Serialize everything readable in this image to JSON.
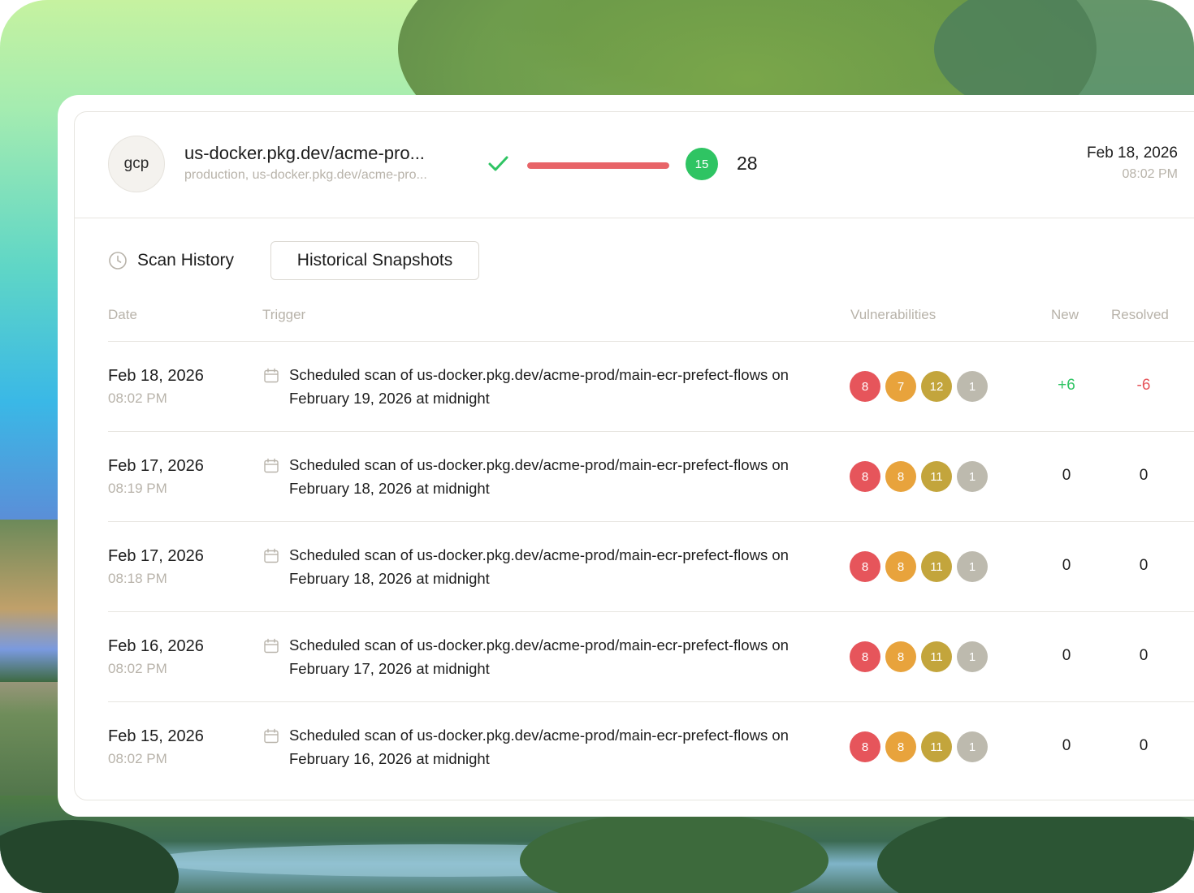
{
  "header": {
    "avatar_text": "gcp",
    "repo_title": "us-docker.pkg.dev/acme-pro...",
    "repo_subtitle": "production, us-docker.pkg.dev/acme-pro...",
    "progress_fraction": 1.0,
    "progress_color": "#e86468",
    "status_badge": "15",
    "total_count": "28",
    "date": "Feb 18, 2026",
    "time": "08:02 PM"
  },
  "tabs": {
    "history_label": "Scan History",
    "snapshots_label": "Historical Snapshots"
  },
  "table": {
    "columns": {
      "date": "Date",
      "trigger": "Trigger",
      "vulnerabilities": "Vulnerabilities",
      "new": "New",
      "resolved": "Resolved"
    },
    "rows": [
      {
        "date": "Feb 18, 2026",
        "time": "08:02 PM",
        "trigger": "Scheduled scan of us-docker.pkg.dev/acme-prod/main-ecr-prefect-flows on February 19, 2026 at midnight",
        "critical": "8",
        "high": "7",
        "medium": "12",
        "low": "1",
        "new": "+6",
        "resolved": "-6"
      },
      {
        "date": "Feb 17, 2026",
        "time": "08:19 PM",
        "trigger": "Scheduled scan of us-docker.pkg.dev/acme-prod/main-ecr-prefect-flows on February 18, 2026 at midnight",
        "critical": "8",
        "high": "8",
        "medium": "11",
        "low": "1",
        "new": "0",
        "resolved": "0"
      },
      {
        "date": "Feb 17, 2026",
        "time": "08:18 PM",
        "trigger": "Scheduled scan of us-docker.pkg.dev/acme-prod/main-ecr-prefect-flows on February 18, 2026 at midnight",
        "critical": "8",
        "high": "8",
        "medium": "11",
        "low": "1",
        "new": "0",
        "resolved": "0"
      },
      {
        "date": "Feb 16, 2026",
        "time": "08:02 PM",
        "trigger": "Scheduled scan of us-docker.pkg.dev/acme-prod/main-ecr-prefect-flows on February 17, 2026 at midnight",
        "critical": "8",
        "high": "8",
        "medium": "11",
        "low": "1",
        "new": "0",
        "resolved": "0"
      },
      {
        "date": "Feb 15, 2026",
        "time": "08:02 PM",
        "trigger": "Scheduled scan of us-docker.pkg.dev/acme-prod/main-ecr-prefect-flows on February 16, 2026 at midnight",
        "critical": "8",
        "high": "8",
        "medium": "11",
        "low": "1",
        "new": "0",
        "resolved": "0"
      }
    ]
  },
  "colors": {
    "critical": "#e6555b",
    "high": "#e8a33c",
    "medium": "#c3a53c",
    "low": "#bdbaae",
    "positive": "#2fc463",
    "negative": "#e6555b"
  }
}
